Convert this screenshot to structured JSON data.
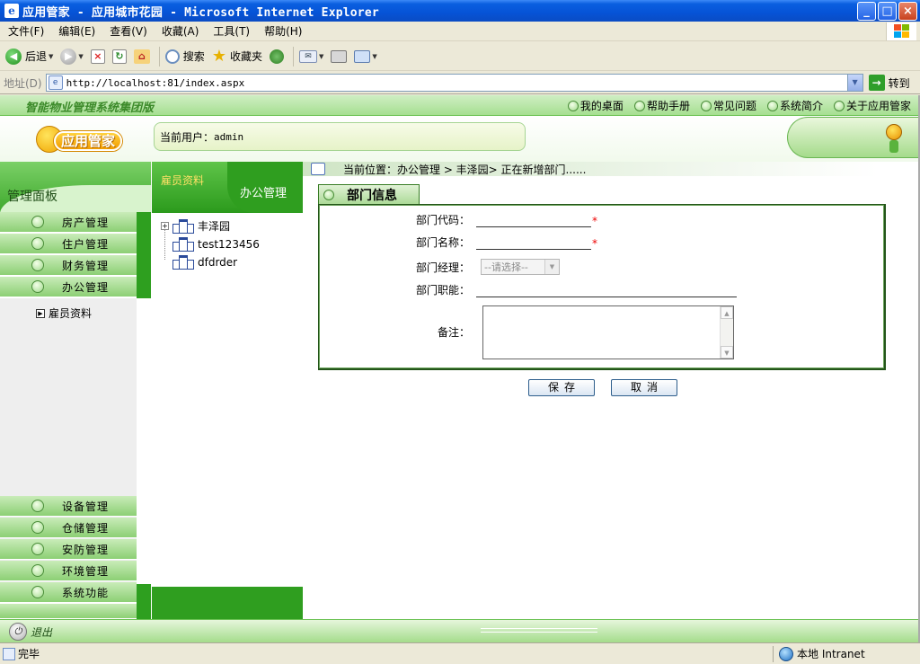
{
  "window": {
    "title": "应用管家 - 应用城市花园 - Microsoft Internet Explorer",
    "buttons": {
      "minimize": "_",
      "maximize": "□",
      "close": "×"
    }
  },
  "menu": [
    "文件(F)",
    "编辑(E)",
    "查看(V)",
    "收藏(A)",
    "工具(T)",
    "帮助(H)"
  ],
  "toolbar": {
    "back": "后退",
    "search": "搜索",
    "favorites": "收藏夹"
  },
  "address": {
    "label": "地址(D)",
    "url": "http://localhost:81/index.aspx",
    "go": "转到"
  },
  "app": {
    "system_title": "智能物业管理系统集团版",
    "logo_text": "应用管家",
    "current_user_label": "当前用户：",
    "current_user": "admin",
    "top_links": [
      "我的桌面",
      "帮助手册",
      "常见问题",
      "系统简介",
      "关于应用管家"
    ]
  },
  "sidebar": {
    "title": "管理面板",
    "top_items": [
      "房产管理",
      "住户管理",
      "财务管理",
      "办公管理"
    ],
    "sub_item": "雇员资料",
    "bottom_items": [
      "设备管理",
      "仓储管理",
      "安防管理",
      "环境管理",
      "系统功能"
    ],
    "logout": "退出"
  },
  "tree": {
    "tab_left": "雇员资料",
    "tab_right": "办公管理",
    "nodes": [
      "丰泽园",
      "test123456",
      "dfdrder"
    ]
  },
  "content": {
    "breadcrumb": "当前位置：办公管理 > 丰泽园> 正在新增部门......",
    "tab_title": "部门信息",
    "fields": {
      "code_label": "部门代码：",
      "name_label": "部门名称：",
      "manager_label": "部门经理：",
      "manager_value": "--请选择--",
      "duty_label": "部门职能：",
      "remark_label": "备注："
    },
    "required_mark": "*",
    "save": "保存",
    "cancel": "取消"
  },
  "status": {
    "left": "完毕",
    "zone": "本地 Intranet"
  }
}
